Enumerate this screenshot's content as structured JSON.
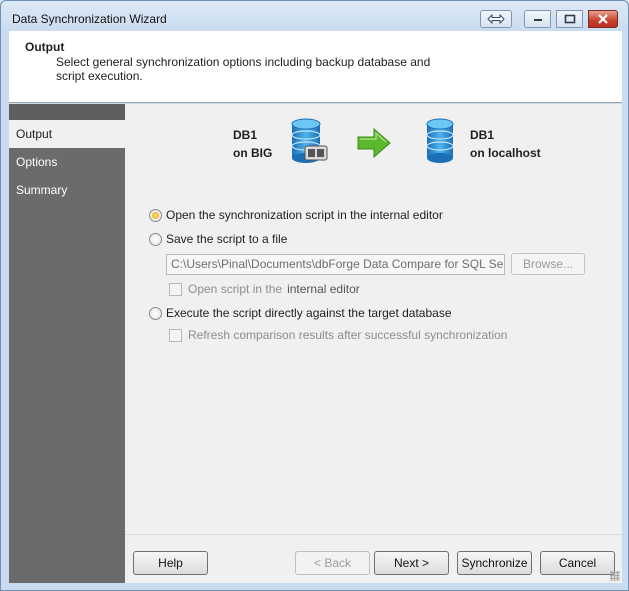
{
  "window": {
    "title": "Data Synchronization Wizard"
  },
  "header": {
    "title": "Output",
    "description": "Select general synchronization options including backup database and script execution."
  },
  "sidebar": {
    "items": [
      {
        "label": "Output",
        "active": true
      },
      {
        "label": "Options",
        "active": false
      },
      {
        "label": "Summary",
        "active": false
      }
    ]
  },
  "source_db": {
    "name": "DB1",
    "server": "on BIG"
  },
  "target_db": {
    "name": "DB1",
    "server": "on localhost"
  },
  "options": {
    "open_in_editor": "Open the synchronization script in the internal editor",
    "save_to_file": "Save the script to a file",
    "file_path": "C:\\Users\\Pinal\\Documents\\dbForge Data Compare for SQL Server\\...",
    "browse_label": "Browse...",
    "open_script_prefix": "Open script in the",
    "open_script_suffix": "internal editor",
    "execute_directly": "Execute the script directly against the target database",
    "refresh_results": "Refresh comparison results after successful synchronization"
  },
  "footer": {
    "help": "Help",
    "back": "< Back",
    "next": "Next >",
    "synchronize": "Synchronize",
    "cancel": "Cancel"
  },
  "colors": {
    "sidebar_bg": "#6b6b6b",
    "content_bg": "#f0f0f0",
    "arrow_green": "#5cb82e",
    "db_blue": "#2a8fd6"
  }
}
